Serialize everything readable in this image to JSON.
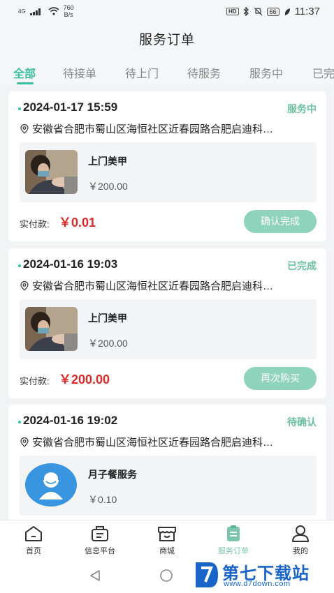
{
  "status_bar": {
    "network": "4G",
    "speed_value": "760",
    "speed_unit": "B/s",
    "hd": "HD",
    "battery": "66",
    "time": "11:37"
  },
  "page_title": "服务订单",
  "tabs": [
    "全部",
    "待接单",
    "待上门",
    "待服务",
    "服务中",
    "已完"
  ],
  "orders": [
    {
      "datetime": "2024-01-17 15:59",
      "status": "服务中",
      "address": "安徽省合肥市蜀山区海恒社区近春园路合肥启迪科…",
      "product_name": "上门美甲",
      "product_price": "￥200.00",
      "pay_label": "实付款:",
      "pay_value": "￥0.01",
      "action": "确认完成"
    },
    {
      "datetime": "2024-01-16 19:03",
      "status": "已完成",
      "address": "安徽省合肥市蜀山区海恒社区近春园路合肥启迪科…",
      "product_name": "上门美甲",
      "product_price": "￥200.00",
      "pay_label": "实付款:",
      "pay_value": "￥200.00",
      "action": "再次购买"
    },
    {
      "datetime": "2024-01-16 19:02",
      "status": "待确认",
      "address": "安徽省合肥市蜀山区海恒社区近春园路合肥启迪科…",
      "product_name": "月子餐服务",
      "product_price": "￥0.10"
    }
  ],
  "bottom_nav": [
    {
      "label": "首页",
      "icon": "home-icon"
    },
    {
      "label": "信息平台",
      "icon": "info-platform-icon"
    },
    {
      "label": "商城",
      "icon": "store-icon"
    },
    {
      "label": "服务订单",
      "icon": "clipboard-icon",
      "active": true
    },
    {
      "label": "我的",
      "icon": "user-icon"
    }
  ],
  "watermark": {
    "title": "第七下载站",
    "url": "www.d7down.com"
  },
  "colors": {
    "accent": "#3bbfa0",
    "price": "#d82b2b",
    "button": "#8fd3bd",
    "status": "#6cbfa1"
  }
}
